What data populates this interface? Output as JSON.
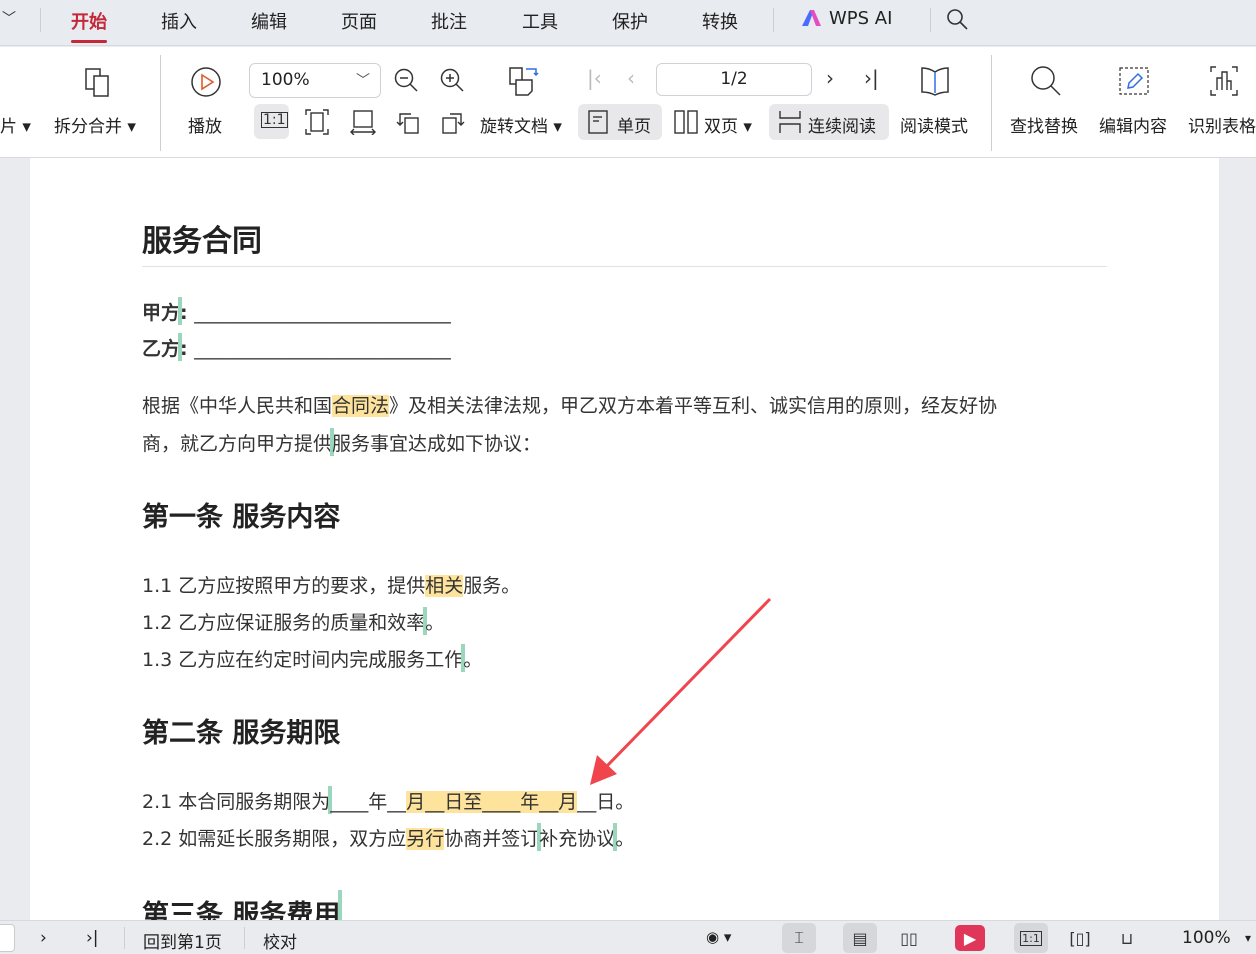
{
  "tabs": [
    "开始",
    "插入",
    "编辑",
    "页面",
    "批注",
    "工具",
    "保护",
    "转换"
  ],
  "wps_ai": "WPS AI",
  "ribbon": {
    "img_partial": "片",
    "split_merge": "拆分合并",
    "play": "播放",
    "zoom_value": "100%",
    "rotate_doc": "旋转文档",
    "page_value": "1/2",
    "single_page": "单页",
    "double_page": "双页",
    "continuous": "连续阅读",
    "read_mode": "阅读模式",
    "find_replace": "查找替换",
    "edit_content": "编辑内容",
    "recognize_table": "识别表格"
  },
  "doc": {
    "title": "服务合同",
    "party_a": "甲方",
    "party_b": "乙方",
    "colon": ":",
    "blank": "___________________________",
    "intro1_a": "根据《中华人民共和国",
    "intro1_hl": "合同法",
    "intro1_b": "》及相关法律法规，甲乙双方本着平等互利、诚实信用的原则，经友好协",
    "intro2_a": "商，就乙方向甲方提供",
    "intro2_b": "服务事宜达成如下协议：",
    "s1": "第一条 服务内容",
    "s1_1a": "1.1 乙方应按照甲方的要求，提供",
    "s1_1hl": "相关",
    "s1_1b": "服务。",
    "s1_2": "1.2 乙方应保证服务的质量和效率",
    "s1_3": "1.3 乙方应在约定时间内完成服务工作",
    "period": "。",
    "s2": "第二条 服务期限",
    "s2_1a": "2.1 本合同服务期限为",
    "s2_1b": "____年__",
    "s2_1hl": "月__日至____年__月",
    "s2_1c": "__日。",
    "s2_2a": "2.2 如需延长服务期限，双方应",
    "s2_2hl": "另行",
    "s2_2b": "协商并签订",
    "s2_2c": "补充协议",
    "s3": "第三条 服务费用"
  },
  "status": {
    "goto_first": "回到第1页",
    "proofread": "校对",
    "zoom": "100%"
  },
  "colors": {
    "accent": "#c4283a",
    "highlight": "#fde39c",
    "cursor": "#9ad7bd",
    "arrow": "#f0454d"
  }
}
